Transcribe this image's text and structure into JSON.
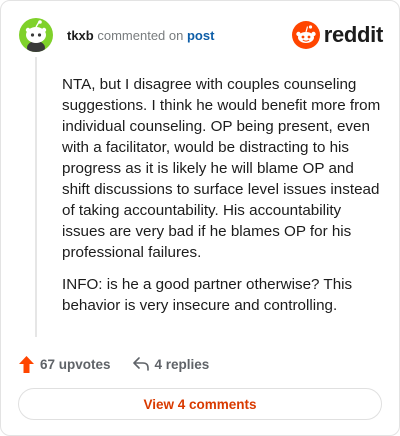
{
  "header": {
    "username": "tkxb",
    "action_text": "commented on",
    "target_text": "post",
    "brand_name": "reddit",
    "avatar_icon": "snoo-avatar-icon",
    "brand_icon": "reddit-logo-icon"
  },
  "comment": {
    "paragraphs": [
      "NTA, but I disagree with couples counseling suggestions. I think he would benefit more from individual counseling. OP being present, even with a facilitator, would be distracting to his progress as it is likely he will blame OP and shift discussions to surface level issues instead of taking accountability. His accountability issues are very bad if he blames OP for his professional failures.",
      "INFO: is he a good partner otherwise? This behavior is very insecure and controlling."
    ]
  },
  "actions": {
    "upvotes_label": "67 upvotes",
    "replies_label": "4 replies",
    "upvote_icon": "upvote-arrow-icon",
    "reply_icon": "reply-arrow-icon"
  },
  "footer": {
    "view_comments_label": "View 4 comments"
  },
  "colors": {
    "avatar_bg": "#7fd12a",
    "reddit_orange": "#ff4500",
    "link_blue": "#0e5ea8",
    "button_text": "#d93a00"
  }
}
